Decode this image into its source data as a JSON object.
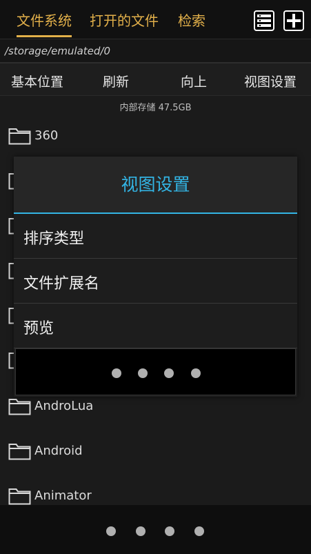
{
  "tabs": [
    {
      "label": "文件系统",
      "active": true
    },
    {
      "label": "打开的文件",
      "active": false
    },
    {
      "label": "检索",
      "active": false
    }
  ],
  "header_icons": [
    "list-icon",
    "add-icon"
  ],
  "path": "/storage/emulated/0",
  "toolbar": {
    "base_label": "基本位置",
    "refresh_label": "刷新",
    "up_label": "向上",
    "view_settings_label": "视图设置"
  },
  "storage_info": "内部存储 47.5GB",
  "files": [
    {
      "name": "360"
    },
    {
      "name": "AndroLua"
    },
    {
      "name": "Android"
    },
    {
      "name": "Animator"
    }
  ],
  "dialog": {
    "title": "视图设置",
    "items": [
      {
        "label": "排序类型"
      },
      {
        "label": "文件扩展名"
      },
      {
        "label": "预览"
      }
    ]
  },
  "colors": {
    "accent_tab": "#e2b04a",
    "dialog_title": "#33b5e5",
    "background": "#1b1b1b"
  }
}
